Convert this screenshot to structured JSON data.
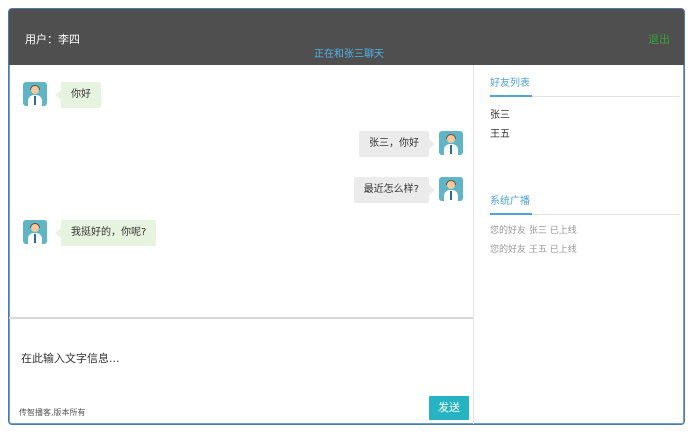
{
  "header": {
    "user_label": "用户：李四",
    "chat_status": "正在和张三聊天",
    "exit_label": "退出"
  },
  "messages": [
    {
      "side": "left",
      "text": "你好"
    },
    {
      "side": "right",
      "text": "张三，你好"
    },
    {
      "side": "right",
      "text": "最近怎么样?"
    },
    {
      "side": "left",
      "text": "我挺好的，你呢?"
    }
  ],
  "composer": {
    "placeholder": "在此输入文字信息...",
    "send_label": "发送",
    "copyright": "传智播客,版本所有"
  },
  "sidebar": {
    "friends_title": "好友列表",
    "friends": [
      "张三",
      "王五"
    ],
    "broadcast_title": "系统广播",
    "broadcasts": [
      "您的好友 张三 已上线",
      "您的好友 王五 已上线"
    ]
  },
  "colors": {
    "header_bg": "#4f4f4f",
    "accent": "#4fa3d6",
    "send_button": "#26b3c2",
    "exit_link": "#36a03c"
  },
  "icons": {
    "avatar": "user-avatar-icon"
  }
}
